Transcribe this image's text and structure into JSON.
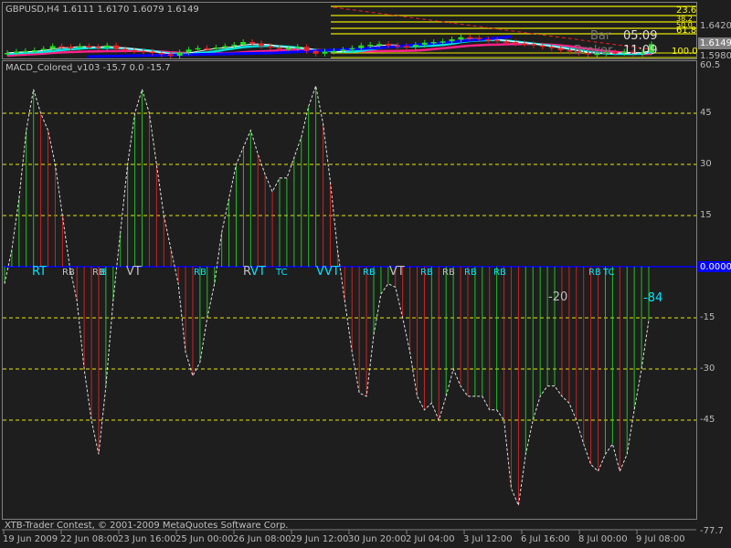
{
  "price_panel": {
    "title": "GBPUSD,H4  1.6111 1.6170 1.6079 1.6149",
    "axis_labels": [
      "1.6420",
      "1.5980"
    ],
    "current_price": "1.6149",
    "fib_levels": [
      "23.6",
      "38.2",
      "50.0",
      "61.8",
      "100.0"
    ],
    "overlay_text": [
      {
        "label": "Bar",
        "value": "05:09"
      },
      {
        "label": "Broker",
        "value": "11:09"
      }
    ],
    "closes": [
      1.602,
      1.604,
      1.605,
      1.606,
      1.608,
      1.612,
      1.611,
      1.61,
      1.612,
      1.611,
      1.61,
      1.613,
      1.608,
      1.606,
      1.605,
      1.604,
      1.602,
      1.6,
      1.598,
      1.603,
      1.607,
      1.609,
      1.608,
      1.61,
      1.612,
      1.614,
      1.618,
      1.616,
      1.612,
      1.61,
      1.609,
      1.609,
      1.611,
      1.605,
      1.601,
      1.604,
      1.605,
      1.607,
      1.609,
      1.613,
      1.614,
      1.615,
      1.613,
      1.612,
      1.611,
      1.614,
      1.617,
      1.618,
      1.619,
      1.622,
      1.625,
      1.624,
      1.622,
      1.621,
      1.619,
      1.618,
      1.616,
      1.615,
      1.613,
      1.611,
      1.609,
      1.606,
      1.604,
      1.602,
      1.6,
      1.601,
      1.603,
      1.602,
      1.604,
      1.601,
      1.603,
      1.6149
    ]
  },
  "indicator_panel": {
    "title": "MACD_Colored_v103 -15.7 0.0 -15.7",
    "axis_labels": [
      "60.5",
      "45",
      "30",
      "15",
      "-15",
      "-30",
      "-45",
      "-77.7"
    ],
    "zero_label": "0.0000",
    "levels": [
      45,
      30,
      15,
      -15,
      -30,
      -45
    ],
    "range": [
      -77.7,
      60.5
    ],
    "values": [
      -5,
      5,
      20,
      40,
      52,
      45,
      40,
      30,
      15,
      0,
      -10,
      -30,
      -45,
      -55,
      -35,
      -10,
      10,
      30,
      45,
      52,
      45,
      30,
      15,
      5,
      -5,
      -25,
      -32,
      -28,
      -15,
      -5,
      10,
      20,
      30,
      35,
      40,
      33,
      27,
      22,
      26,
      26,
      32,
      38,
      47,
      53,
      42,
      25,
      5,
      -10,
      -25,
      -37,
      -38,
      -20,
      -8,
      -5,
      -6,
      -15,
      -25,
      -38,
      -42,
      -40,
      -45,
      -38,
      -30,
      -35,
      -38,
      -38,
      -38,
      -42,
      -42,
      -45,
      -65,
      -70,
      -55,
      -45,
      -38,
      -35,
      -35,
      -38,
      -40,
      -45,
      -52,
      -58,
      -60,
      -55,
      -52,
      -60,
      -55,
      -42,
      -30,
      -15.7
    ],
    "markers": [
      {
        "text": "RT",
        "color": "#00e5ff",
        "big": true
      },
      {
        "text": "RB",
        "color": "#c0c0c0"
      },
      {
        "text": "RB",
        "color": "#c0c0c0"
      },
      {
        "text": "B",
        "color": "#00e5ff"
      },
      {
        "text": "VT",
        "color": "#c0c0c0",
        "big": true
      },
      {
        "text": "RB",
        "color": "#00e5ff"
      },
      {
        "text": "R",
        "color": "#c0c0c0",
        "big": true
      },
      {
        "text": "VT",
        "color": "#00e5ff",
        "big": true
      },
      {
        "text": "TC",
        "color": "#00e5ff"
      },
      {
        "text": "VVT",
        "color": "#00e5ff",
        "big": true
      },
      {
        "text": "RB",
        "color": "#00e5ff"
      },
      {
        "text": "VT",
        "color": "#c0c0c0",
        "big": true
      },
      {
        "text": "RB",
        "color": "#00e5ff"
      },
      {
        "text": "RB",
        "color": "#c0c0c0"
      },
      {
        "text": "RB",
        "color": "#00e5ff"
      },
      {
        "text": "RB",
        "color": "#00e5ff"
      },
      {
        "text": "RB",
        "color": "#00e5ff"
      },
      {
        "text": "TC",
        "color": "#00e5ff"
      },
      {
        "text": "-20",
        "color": "#c0c0c0",
        "big": true
      },
      {
        "text": "-84",
        "color": "#00e5ff",
        "big": true
      }
    ]
  },
  "footer": {
    "copyright": "XTB-Trader Contest, © 2001-2009 MetaQuotes Software Corp."
  },
  "time_axis": [
    "19 Jun 2009",
    "22 Jun 08:00",
    "23 Jun 16:00",
    "25 Jun 00:00",
    "26 Jun 08:00",
    "29 Jun 12:00",
    "30 Jun 20:00",
    "2 Jul 04:00",
    "3 Jul 12:00",
    "6 Jul 16:00",
    "8 Jul 00:00",
    "9 Jul 08:00"
  ],
  "colors": {
    "up": "#22dd22",
    "down": "#ee2222",
    "level": "#e8e800",
    "zero": "#0000ff",
    "ma_fast": "#ffffff",
    "ma_mid": "#00e5e5",
    "ma_slow": "#ff2288",
    "ma_long": "#0000ff"
  }
}
